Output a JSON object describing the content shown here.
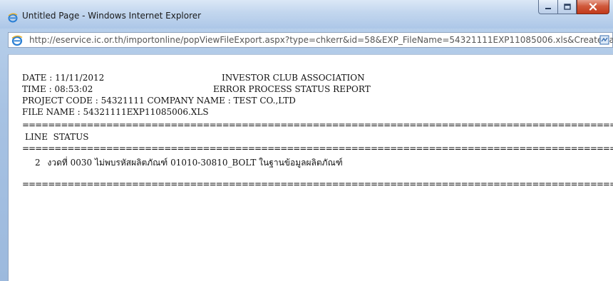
{
  "window": {
    "title": "Untitled Page - Windows Internet Explorer"
  },
  "address_bar": {
    "url": "http://eservice.ic.or.th/importonline/popViewFileExport.aspx?type=chkerr&id=58&EXP_FileName=54321111EXP11085006.xls&CreateDa"
  },
  "report": {
    "date_line": "DATE : 11/11/2012",
    "org_name": "INVESTOR CLUB ASSOCIATION",
    "time_line": "TIME : 08:53:02",
    "report_title": "ERROR PROCESS STATUS REPORT",
    "project_line": "PROJECT CODE : 54321111 COMPANY NAME : TEST CO.,LTD",
    "file_line": "FILE NAME : 54321111EXP11085006.XLS",
    "separator": "=============================================================================================================",
    "column_header": "LINE  STATUS",
    "rows": [
      {
        "line": "2",
        "status": "งวดที่ 0030 ไม่พบรหัสผลิตภัณฑ์ 01010-30810_BOLT ในฐานข้อมูลผลิตภัณฑ์"
      }
    ]
  },
  "icons": {
    "title_icon": "ie-logo-icon",
    "address_icon": "ie-page-icon",
    "address_right_icon": "compatibility-view-icon",
    "minimize": "minimize-icon",
    "maximize": "maximize-icon",
    "close": "close-icon"
  },
  "colors": {
    "close_button": "#c2391a",
    "chrome": "#adc7e8"
  }
}
